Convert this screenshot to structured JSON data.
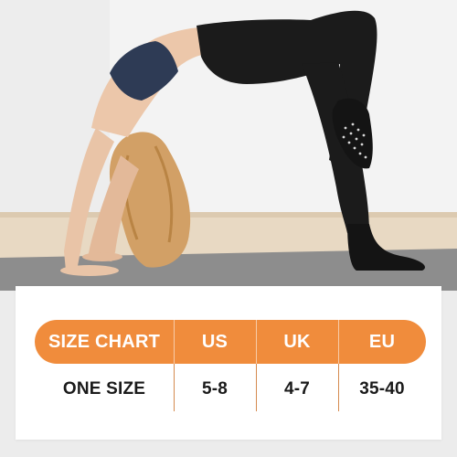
{
  "size_chart": {
    "header": [
      "SIZE CHART",
      "US",
      "UK",
      "EU"
    ],
    "row": [
      "ONE SIZE",
      "5-8",
      "4-7",
      "35-40"
    ]
  },
  "colors": {
    "accent": "#f08c3c",
    "wall": "#f3f3f3",
    "floor": "#e8d9c3",
    "mat": "#8d8d8d",
    "outfit": "#1b1b1b",
    "bra": "#2e3b55",
    "hair": "#d2a066"
  }
}
